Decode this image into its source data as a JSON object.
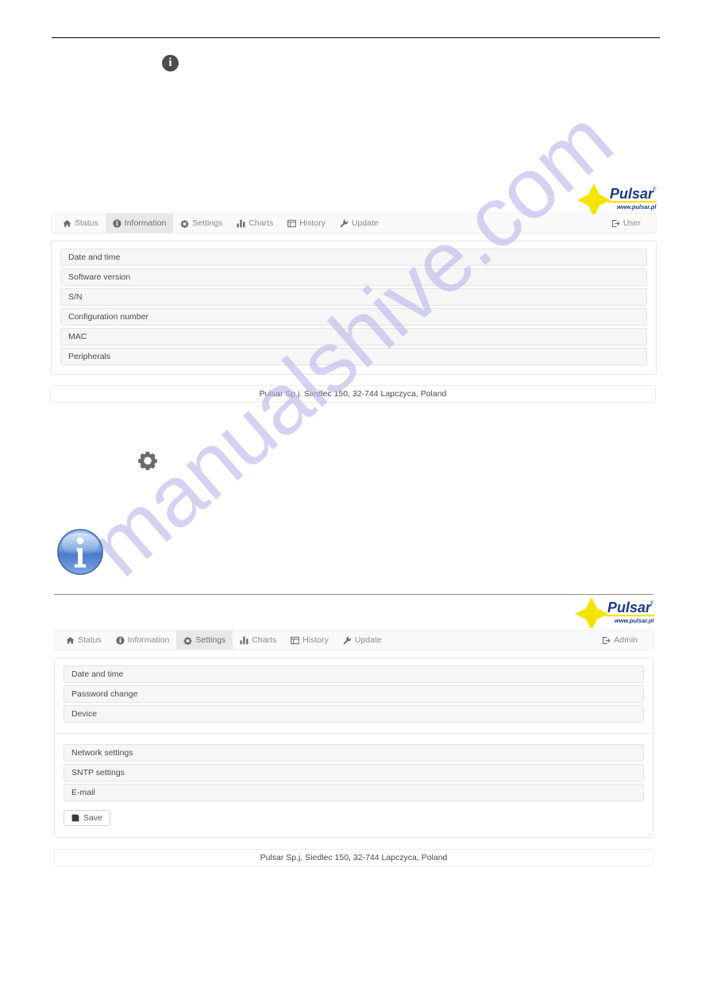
{
  "watermark": {
    "text": "manualshive.com"
  },
  "logo": {
    "brand": "Pulsar",
    "registered": "®",
    "url": "www.pulsar.pl"
  },
  "doc_icons": {
    "info_dark": "info-circle-icon",
    "gear": "gear-icon",
    "info_big": "info-circle-large-icon"
  },
  "screen_information": {
    "nav": {
      "items": [
        {
          "label": "Status",
          "icon": "home-icon",
          "active": false
        },
        {
          "label": "Information",
          "icon": "info-circle-icon",
          "active": true
        },
        {
          "label": "Settings",
          "icon": "gear-icon",
          "active": false
        },
        {
          "label": "Charts",
          "icon": "bar-chart-icon",
          "active": false
        },
        {
          "label": "History",
          "icon": "table-icon",
          "active": false
        },
        {
          "label": "Update",
          "icon": "wrench-icon",
          "active": false
        }
      ],
      "account": {
        "label": "User",
        "icon": "sign-out-icon"
      }
    },
    "groups": [
      {
        "items": [
          {
            "label": "Date and time"
          },
          {
            "label": "Software version"
          },
          {
            "label": "S/N"
          },
          {
            "label": "Configuration number"
          },
          {
            "label": "MAC"
          },
          {
            "label": "Peripherals"
          }
        ]
      }
    ],
    "footer": "Pulsar Sp.j. Siedlec 150, 32-744 Lapczyca, Poland"
  },
  "screen_settings": {
    "nav": {
      "items": [
        {
          "label": "Status",
          "icon": "home-icon",
          "active": false
        },
        {
          "label": "Information",
          "icon": "info-circle-icon",
          "active": false
        },
        {
          "label": "Settings",
          "icon": "gear-icon",
          "active": true
        },
        {
          "label": "Charts",
          "icon": "bar-chart-icon",
          "active": false
        },
        {
          "label": "History",
          "icon": "table-icon",
          "active": false
        },
        {
          "label": "Update",
          "icon": "wrench-icon",
          "active": false
        }
      ],
      "account": {
        "label": "Admin",
        "icon": "sign-out-icon"
      }
    },
    "groups": [
      {
        "items": [
          {
            "label": "Date and time"
          },
          {
            "label": "Password change"
          },
          {
            "label": "Device"
          }
        ]
      },
      {
        "items": [
          {
            "label": "Network settings"
          },
          {
            "label": "SNTP settings"
          },
          {
            "label": "E-mail"
          }
        ]
      }
    ],
    "save_button": {
      "label": "Save",
      "icon": "floppy-save-icon"
    },
    "footer": "Pulsar Sp.j. Siedlec 150, 32-744 Lapczyca, Poland"
  },
  "colors": {
    "logo_blue": "#1b3a8c",
    "logo_yellow": "#f5e400",
    "watermark": "#bcb8ea",
    "nav_bg": "#fafafa",
    "active_tab": "#e8e8e8",
    "item_bg": "#f6f6f6"
  }
}
